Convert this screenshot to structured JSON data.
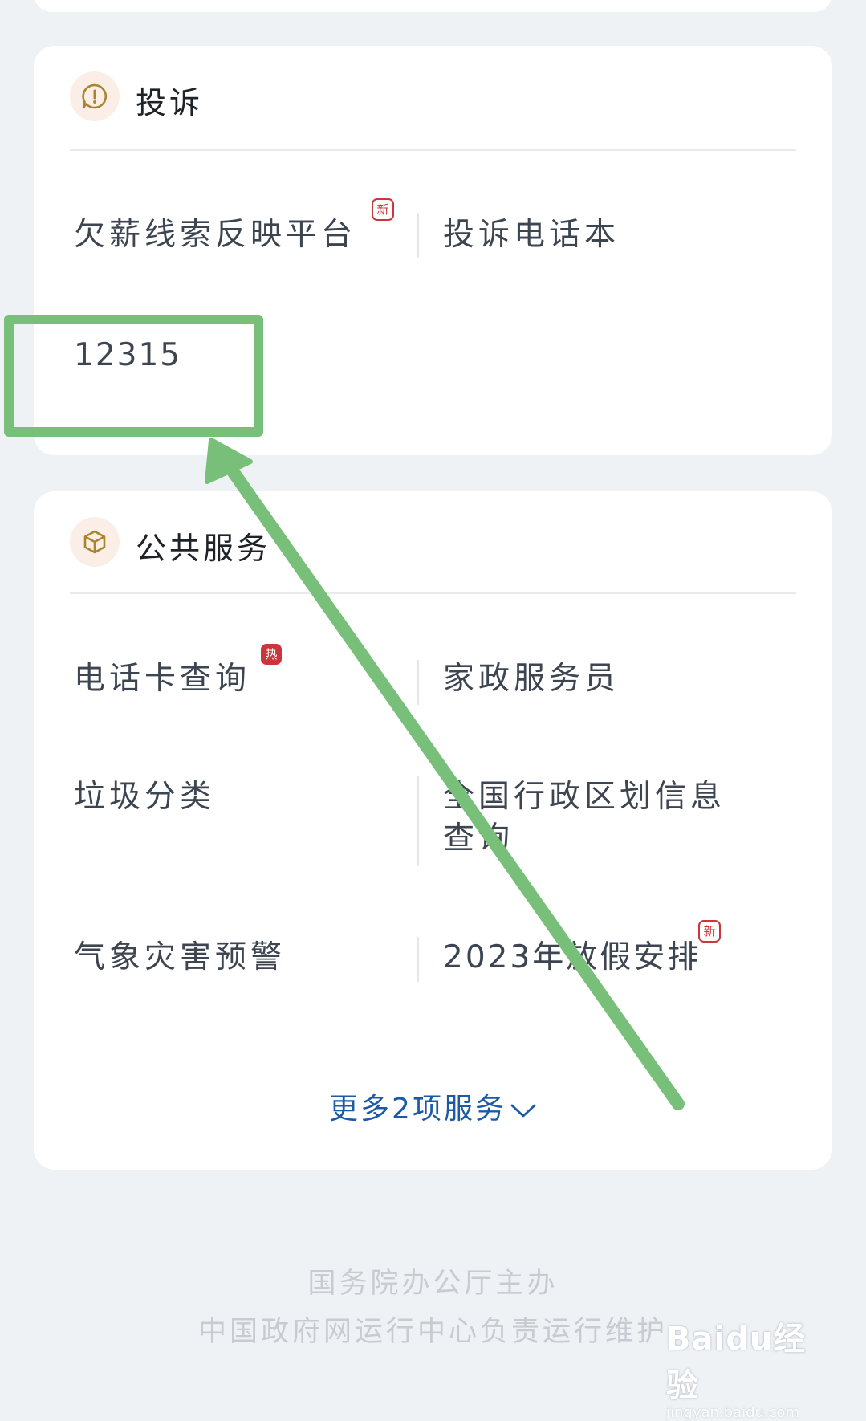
{
  "complaint_section": {
    "title": "投诉",
    "icon": "alert-bubble-icon",
    "items": [
      {
        "label": "欠薪线索反映平台",
        "badge": "新"
      },
      {
        "label": "投诉电话本"
      },
      {
        "label": "12315"
      }
    ]
  },
  "public_service_section": {
    "title": "公共服务",
    "icon": "cube-icon",
    "items": [
      {
        "label": "电话卡查询",
        "badge": "热"
      },
      {
        "label": "家政服务员"
      },
      {
        "label": "垃圾分类"
      },
      {
        "label": "全国行政区划信息查询"
      },
      {
        "label": "气象灾害预警"
      },
      {
        "label": "2023年放假安排",
        "badge": "新"
      }
    ],
    "more_link": "更多2项服务"
  },
  "footer": {
    "line1": "国务院办公厅主办",
    "line2": "中国政府网运行中心负责运行维护"
  },
  "watermark": {
    "brand": "Baidu经验",
    "url": "jingyan.baidu.com"
  },
  "colors": {
    "accent_link": "#1c5aa6",
    "badge_red": "#c9363b",
    "annotation_green": "#78c07a",
    "icon_gold": "#a8842a"
  }
}
